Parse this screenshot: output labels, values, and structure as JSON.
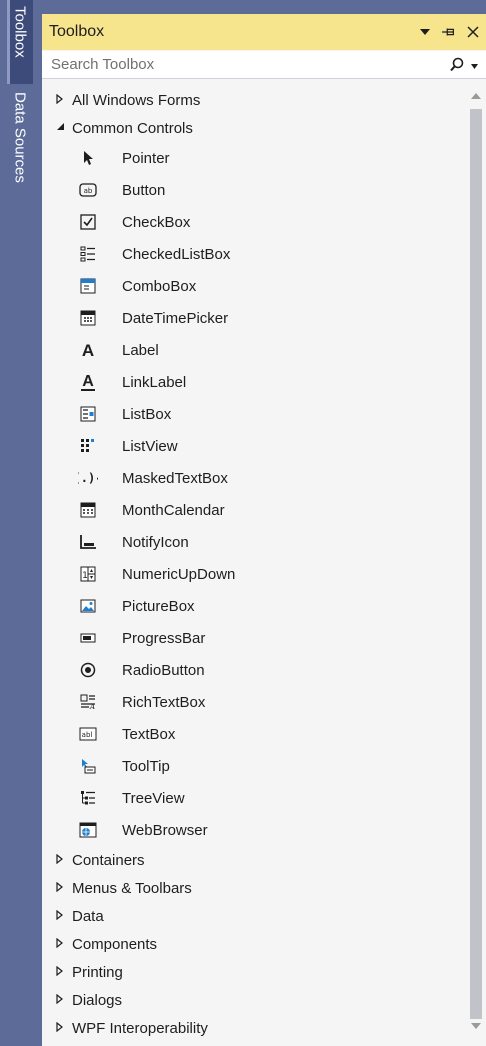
{
  "side_tabs": [
    {
      "label": "Toolbox",
      "active": true
    },
    {
      "label": "Data Sources",
      "active": false
    }
  ],
  "panel": {
    "title": "Toolbox",
    "search_placeholder": "Search Toolbox"
  },
  "categories_top": [
    {
      "label": "All Windows Forms",
      "expanded": false
    },
    {
      "label": "Common Controls",
      "expanded": true
    }
  ],
  "items": [
    {
      "label": "Pointer",
      "icon": "pointer-icon"
    },
    {
      "label": "Button",
      "icon": "button-icon"
    },
    {
      "label": "CheckBox",
      "icon": "checkbox-icon"
    },
    {
      "label": "CheckedListBox",
      "icon": "checked-list-box-icon"
    },
    {
      "label": "ComboBox",
      "icon": "combo-box-icon"
    },
    {
      "label": "DateTimePicker",
      "icon": "date-time-picker-icon"
    },
    {
      "label": "Label",
      "icon": "label-icon"
    },
    {
      "label": "LinkLabel",
      "icon": "link-label-icon"
    },
    {
      "label": "ListBox",
      "icon": "list-box-icon"
    },
    {
      "label": "ListView",
      "icon": "list-view-icon"
    },
    {
      "label": "MaskedTextBox",
      "icon": "masked-text-box-icon"
    },
    {
      "label": "MonthCalendar",
      "icon": "month-calendar-icon"
    },
    {
      "label": "NotifyIcon",
      "icon": "notify-icon-icon"
    },
    {
      "label": "NumericUpDown",
      "icon": "numeric-up-down-icon"
    },
    {
      "label": "PictureBox",
      "icon": "picture-box-icon"
    },
    {
      "label": "ProgressBar",
      "icon": "progress-bar-icon"
    },
    {
      "label": "RadioButton",
      "icon": "radio-button-icon"
    },
    {
      "label": "RichTextBox",
      "icon": "rich-text-box-icon"
    },
    {
      "label": "TextBox",
      "icon": "text-box-icon"
    },
    {
      "label": "ToolTip",
      "icon": "tooltip-icon"
    },
    {
      "label": "TreeView",
      "icon": "tree-view-icon"
    },
    {
      "label": "WebBrowser",
      "icon": "web-browser-icon"
    }
  ],
  "categories_bottom": [
    {
      "label": "Containers"
    },
    {
      "label": "Menus & Toolbars"
    },
    {
      "label": "Data"
    },
    {
      "label": "Components"
    },
    {
      "label": "Printing"
    },
    {
      "label": "Dialogs"
    },
    {
      "label": "WPF Interoperability"
    }
  ],
  "colors": {
    "title_bar": "#f6e58d",
    "frame": "#5d6b99",
    "panel_bg": "#f5f5f5",
    "accent_blue": "#1e7fd0"
  }
}
